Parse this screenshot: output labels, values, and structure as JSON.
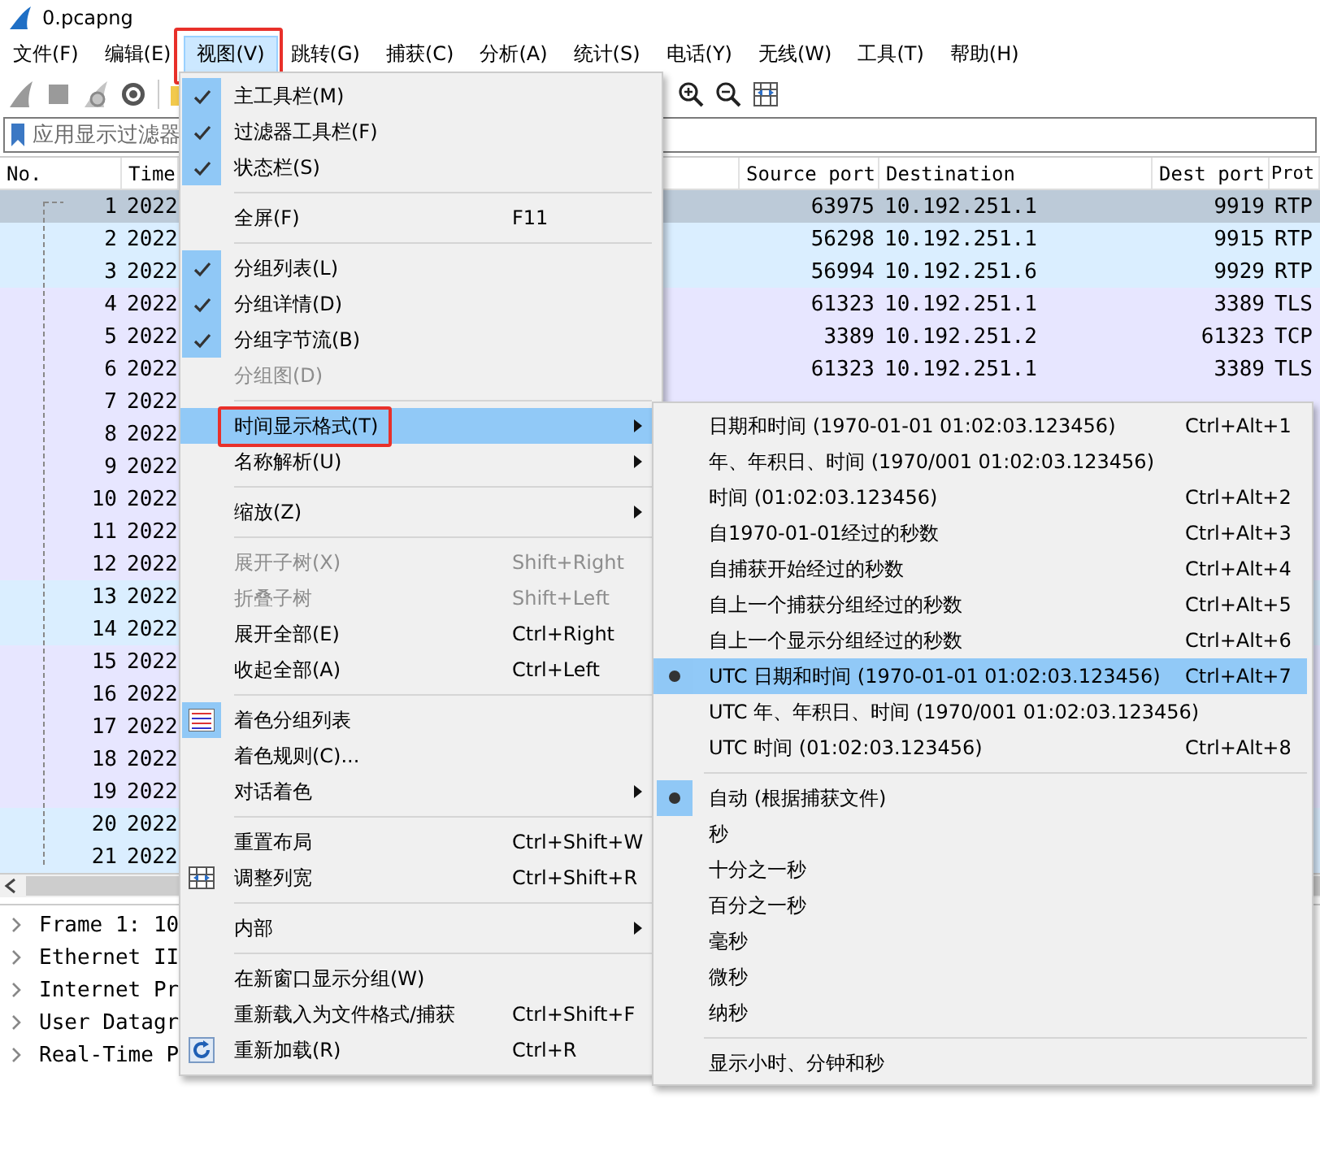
{
  "window": {
    "title": "0.pcapng"
  },
  "menubar": [
    {
      "label": "文件(F)",
      "selected": false,
      "annotated": false
    },
    {
      "label": "编辑(E)",
      "selected": false,
      "annotated": false
    },
    {
      "label": "视图(V)",
      "selected": true,
      "annotated": true
    },
    {
      "label": "跳转(G)",
      "selected": false,
      "annotated": false
    },
    {
      "label": "捕获(C)",
      "selected": false,
      "annotated": false
    },
    {
      "label": "分析(A)",
      "selected": false,
      "annotated": false
    },
    {
      "label": "统计(S)",
      "selected": false,
      "annotated": false
    },
    {
      "label": "电话(Y)",
      "selected": false,
      "annotated": false
    },
    {
      "label": "无线(W)",
      "selected": false,
      "annotated": false
    },
    {
      "label": "工具(T)",
      "selected": false,
      "annotated": false
    },
    {
      "label": "帮助(H)",
      "selected": false,
      "annotated": false
    }
  ],
  "filter": {
    "placeholder": "应用显示过滤器"
  },
  "packet_list": {
    "columns": [
      "No.",
      "Time",
      "Source port",
      "Destination",
      "Dest port",
      "Prot"
    ],
    "rows": [
      {
        "no": "1",
        "time": "2022",
        "source_port": "63975",
        "destination": "10.192.251.1",
        "dest_port": "9919",
        "protocol": "RTP",
        "selected": true
      },
      {
        "no": "2",
        "time": "2022",
        "source_port": "56298",
        "destination": "10.192.251.1",
        "dest_port": "9915",
        "protocol": "RTP",
        "color": "#daeeff",
        "selected": false
      },
      {
        "no": "3",
        "time": "2022",
        "source_port": "56994",
        "destination": "10.192.251.6",
        "dest_port": "9929",
        "protocol": "RTP",
        "color": "#daeeff",
        "selected": false
      },
      {
        "no": "4",
        "time": "2022",
        "source_port": "61323",
        "destination": "10.192.251.1",
        "dest_port": "3389",
        "protocol": "TLS",
        "color": "#e7e6ff",
        "selected": false
      },
      {
        "no": "5",
        "time": "2022",
        "source_port": "3389",
        "destination": "10.192.251.2",
        "dest_port": "61323",
        "protocol": "TCP",
        "color": "#e7e6ff",
        "selected": false
      },
      {
        "no": "6",
        "time": "2022",
        "source_port": "61323",
        "destination": "10.192.251.1",
        "dest_port": "3389",
        "protocol": "TLS",
        "color": "#e7e6ff",
        "selected": false
      },
      {
        "no": "7",
        "time": "2022",
        "color": "#e7e6ff",
        "selected": false
      },
      {
        "no": "8",
        "time": "2022",
        "color": "#e7e6ff",
        "selected": false
      },
      {
        "no": "9",
        "time": "2022",
        "color": "#e7e6ff",
        "selected": false
      },
      {
        "no": "10",
        "time": "2022",
        "color": "#e7e6ff",
        "selected": false
      },
      {
        "no": "11",
        "time": "2022",
        "color": "#e7e6ff",
        "selected": false
      },
      {
        "no": "12",
        "time": "2022",
        "color": "#e7e6ff",
        "selected": false
      },
      {
        "no": "13",
        "time": "2022",
        "color": "#daeeff",
        "selected": false
      },
      {
        "no": "14",
        "time": "2022",
        "color": "#daeeff",
        "selected": false
      },
      {
        "no": "15",
        "time": "2022",
        "color": "#e7e6ff",
        "selected": false
      },
      {
        "no": "16",
        "time": "2022",
        "color": "#e7e6ff",
        "selected": false
      },
      {
        "no": "17",
        "time": "2022",
        "color": "#e7e6ff",
        "selected": false
      },
      {
        "no": "18",
        "time": "2022",
        "color": "#e7e6ff",
        "selected": false
      },
      {
        "no": "19",
        "time": "2022",
        "color": "#e7e6ff",
        "selected": false
      },
      {
        "no": "20",
        "time": "2022",
        "color": "#daeeff",
        "selected": false
      },
      {
        "no": "21",
        "time": "2022",
        "color": "#daeeff",
        "selected": false
      }
    ]
  },
  "details": [
    {
      "text": "Frame 1: 10",
      "expanded": false
    },
    {
      "text": "Ethernet II",
      "expanded": false
    },
    {
      "text": "Internet Pr",
      "expanded": false
    },
    {
      "text": "User Datagr",
      "expanded": false
    },
    {
      "text": "Real-Time P",
      "expanded": false
    }
  ],
  "view_menu": {
    "items": [
      {
        "kind": "check",
        "label": "主工具栏(M)",
        "checked": true,
        "disabled": false,
        "highlighted": false
      },
      {
        "kind": "check",
        "label": "过滤器工具栏(F)",
        "checked": true,
        "disabled": false,
        "highlighted": false
      },
      {
        "kind": "check",
        "label": "状态栏(S)",
        "checked": true,
        "disabled": false,
        "highlighted": false
      },
      {
        "kind": "separator"
      },
      {
        "kind": "plain",
        "label": "全屏(F)",
        "shortcut": "F11",
        "disabled": false,
        "highlighted": false
      },
      {
        "kind": "separator"
      },
      {
        "kind": "check",
        "label": "分组列表(L)",
        "checked": true,
        "disabled": false,
        "highlighted": false
      },
      {
        "kind": "check",
        "label": "分组详情(D)",
        "checked": true,
        "disabled": false,
        "highlighted": false
      },
      {
        "kind": "check",
        "label": "分组字节流(B)",
        "checked": true,
        "disabled": false,
        "highlighted": false
      },
      {
        "kind": "check",
        "label": "分组图(D)",
        "checked": false,
        "disabled": true,
        "highlighted": false
      },
      {
        "kind": "separator"
      },
      {
        "kind": "submenu",
        "label": "时间显示格式(T)",
        "disabled": false,
        "highlighted": true,
        "annotated": true
      },
      {
        "kind": "submenu",
        "label": "名称解析(U)",
        "disabled": false,
        "highlighted": false,
        "annotated": false
      },
      {
        "kind": "separator"
      },
      {
        "kind": "submenu",
        "label": "缩放(Z)",
        "disabled": false,
        "highlighted": false,
        "annotated": false
      },
      {
        "kind": "separator"
      },
      {
        "kind": "plain",
        "label": "展开子树(X)",
        "shortcut": "Shift+Right",
        "disabled": true,
        "highlighted": false
      },
      {
        "kind": "plain",
        "label": "折叠子树",
        "shortcut": "Shift+Left",
        "disabled": true,
        "highlighted": false
      },
      {
        "kind": "plain",
        "label": "展开全部(E)",
        "shortcut": "Ctrl+Right",
        "disabled": false,
        "highlighted": false
      },
      {
        "kind": "plain",
        "label": "收起全部(A)",
        "shortcut": "Ctrl+Left",
        "disabled": false,
        "highlighted": false
      },
      {
        "kind": "separator"
      },
      {
        "kind": "colorize",
        "label": "着色分组列表",
        "checked": true,
        "disabled": false,
        "highlighted": false
      },
      {
        "kind": "plain",
        "label": "着色规则(C)...",
        "disabled": false,
        "highlighted": false
      },
      {
        "kind": "submenu",
        "label": "对话着色",
        "disabled": false,
        "highlighted": false,
        "annotated": false
      },
      {
        "kind": "separator"
      },
      {
        "kind": "plain",
        "label": "重置布局",
        "shortcut": "Ctrl+Shift+W",
        "disabled": false,
        "highlighted": false
      },
      {
        "kind": "resize",
        "label": "调整列宽",
        "shortcut": "Ctrl+Shift+R",
        "disabled": false,
        "highlighted": false
      },
      {
        "kind": "separator"
      },
      {
        "kind": "submenu",
        "label": "内部",
        "disabled": false,
        "highlighted": false,
        "annotated": false
      },
      {
        "kind": "separator"
      },
      {
        "kind": "plain",
        "label": "在新窗口显示分组(W)",
        "disabled": false,
        "highlighted": false
      },
      {
        "kind": "plain",
        "label": "重新载入为文件格式/捕获",
        "shortcut": "Ctrl+Shift+F",
        "disabled": false,
        "highlighted": false
      },
      {
        "kind": "reload",
        "label": "重新加载(R)",
        "shortcut": "Ctrl+R",
        "disabled": false,
        "highlighted": false
      }
    ]
  },
  "time_format_menu": {
    "items": [
      {
        "kind": "radio",
        "label": "日期和时间 (1970-01-01 01:02:03.123456)",
        "shortcut": "Ctrl+Alt+1",
        "selected": false,
        "highlighted": false
      },
      {
        "kind": "radio",
        "label": "年、年积日、时间 (1970/001 01:02:03.123456)",
        "selected": false,
        "highlighted": false
      },
      {
        "kind": "radio",
        "label": "时间 (01:02:03.123456)",
        "shortcut": "Ctrl+Alt+2",
        "selected": false,
        "highlighted": false
      },
      {
        "kind": "radio",
        "label": "自1970-01-01经过的秒数",
        "shortcut": "Ctrl+Alt+3",
        "selected": false,
        "highlighted": false
      },
      {
        "kind": "radio",
        "label": "自捕获开始经过的秒数",
        "shortcut": "Ctrl+Alt+4",
        "selected": false,
        "highlighted": false
      },
      {
        "kind": "radio",
        "label": "自上一个捕获分组经过的秒数",
        "shortcut": "Ctrl+Alt+5",
        "selected": false,
        "highlighted": false
      },
      {
        "kind": "radio",
        "label": "自上一个显示分组经过的秒数",
        "shortcut": "Ctrl+Alt+6",
        "selected": false,
        "highlighted": false
      },
      {
        "kind": "radio",
        "label": "UTC 日期和时间 (1970-01-01 01:02:03.123456)",
        "shortcut": "Ctrl+Alt+7",
        "selected": true,
        "highlighted": true
      },
      {
        "kind": "radio",
        "label": "UTC 年、年积日、时间 (1970/001 01:02:03.123456)",
        "selected": false,
        "highlighted": false
      },
      {
        "kind": "radio",
        "label": "UTC 时间 (01:02:03.123456)",
        "shortcut": "Ctrl+Alt+8",
        "selected": false,
        "highlighted": false
      },
      {
        "kind": "separator"
      },
      {
        "kind": "radio",
        "label": "自动 (根据捕获文件)",
        "selected": true,
        "highlighted": false
      },
      {
        "kind": "radio",
        "label": "秒",
        "selected": false,
        "highlighted": false
      },
      {
        "kind": "radio",
        "label": "十分之一秒",
        "selected": false,
        "highlighted": false
      },
      {
        "kind": "radio",
        "label": "百分之一秒",
        "selected": false,
        "highlighted": false
      },
      {
        "kind": "radio",
        "label": "毫秒",
        "selected": false,
        "highlighted": false
      },
      {
        "kind": "radio",
        "label": "微秒",
        "selected": false,
        "highlighted": false
      },
      {
        "kind": "radio",
        "label": "纳秒",
        "selected": false,
        "highlighted": false
      },
      {
        "kind": "separator"
      },
      {
        "kind": "check",
        "label": "显示小时、分钟和秒",
        "checked": false,
        "highlighted": false
      }
    ]
  }
}
